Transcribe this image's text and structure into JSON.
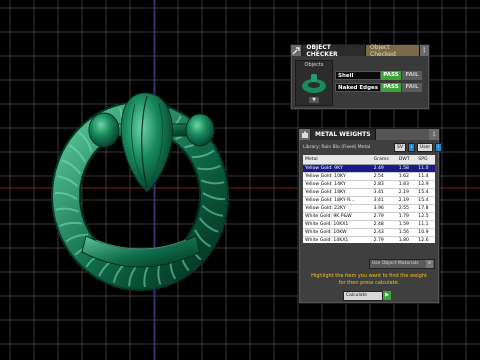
{
  "object_checker": {
    "tab_active": "OBJECT CHECKER",
    "tab_inactive": "Object Checked",
    "objects_label": "Objects",
    "down_arrow": "▼",
    "checks": [
      {
        "name": "Shell",
        "pass": "PASS",
        "fail": "FAIL"
      },
      {
        "name": "Naked Edges",
        "pass": "PASS",
        "fail": "FAIL"
      }
    ]
  },
  "metal_weights": {
    "title": "METAL WEIGHTS",
    "library": "Library: Rain Blo (Fixed) Metal",
    "btn_sv": "SV",
    "btn_user": "User",
    "columns": [
      "Metal",
      "Grams",
      "DWT",
      "SPG"
    ],
    "rows": [
      [
        "Yellow Gold: 9KY",
        "2.49",
        "1.58",
        "11.0"
      ],
      [
        "Yellow Gold: 10KY",
        "2.54",
        "1.62",
        "11.4"
      ],
      [
        "Yellow Gold: 14KY",
        "2.83",
        "1.83",
        "12.9"
      ],
      [
        "Yellow Gold: 18KY",
        "3.41",
        "2.19",
        "15.4"
      ],
      [
        "Yellow Gold: 18KY R...",
        "3.41",
        "2.19",
        "15.4"
      ],
      [
        "Yellow Gold: 22KY",
        "3.96",
        "2.55",
        "17.8"
      ],
      [
        "White Gold: 9K P&W",
        "2.79",
        "1.79",
        "12.5"
      ],
      [
        "White Gold: 10KX1",
        "2.48",
        "1.59",
        "11.1"
      ],
      [
        "White Gold: 10KW",
        "2.43",
        "1.56",
        "10.9"
      ],
      [
        "White Gold: 14KX1",
        "2.79",
        "1.80",
        "12.6"
      ],
      [
        "White Gold: 14K P&W",
        "3.18",
        "2.05",
        "14.3"
      ]
    ],
    "use_object_materials": "Use Object Materials",
    "hint": "Highlight the item you want to find the weight for then press calculate.",
    "calculate_label": "Calculate",
    "go_arrow": "▶"
  },
  "colors": {
    "ring": "#0f6b4a",
    "grid": "#3a3a3a",
    "axis_red": "#8b1a1a",
    "axis_blue": "#2a2ab0",
    "hint": "#f2c21b"
  }
}
